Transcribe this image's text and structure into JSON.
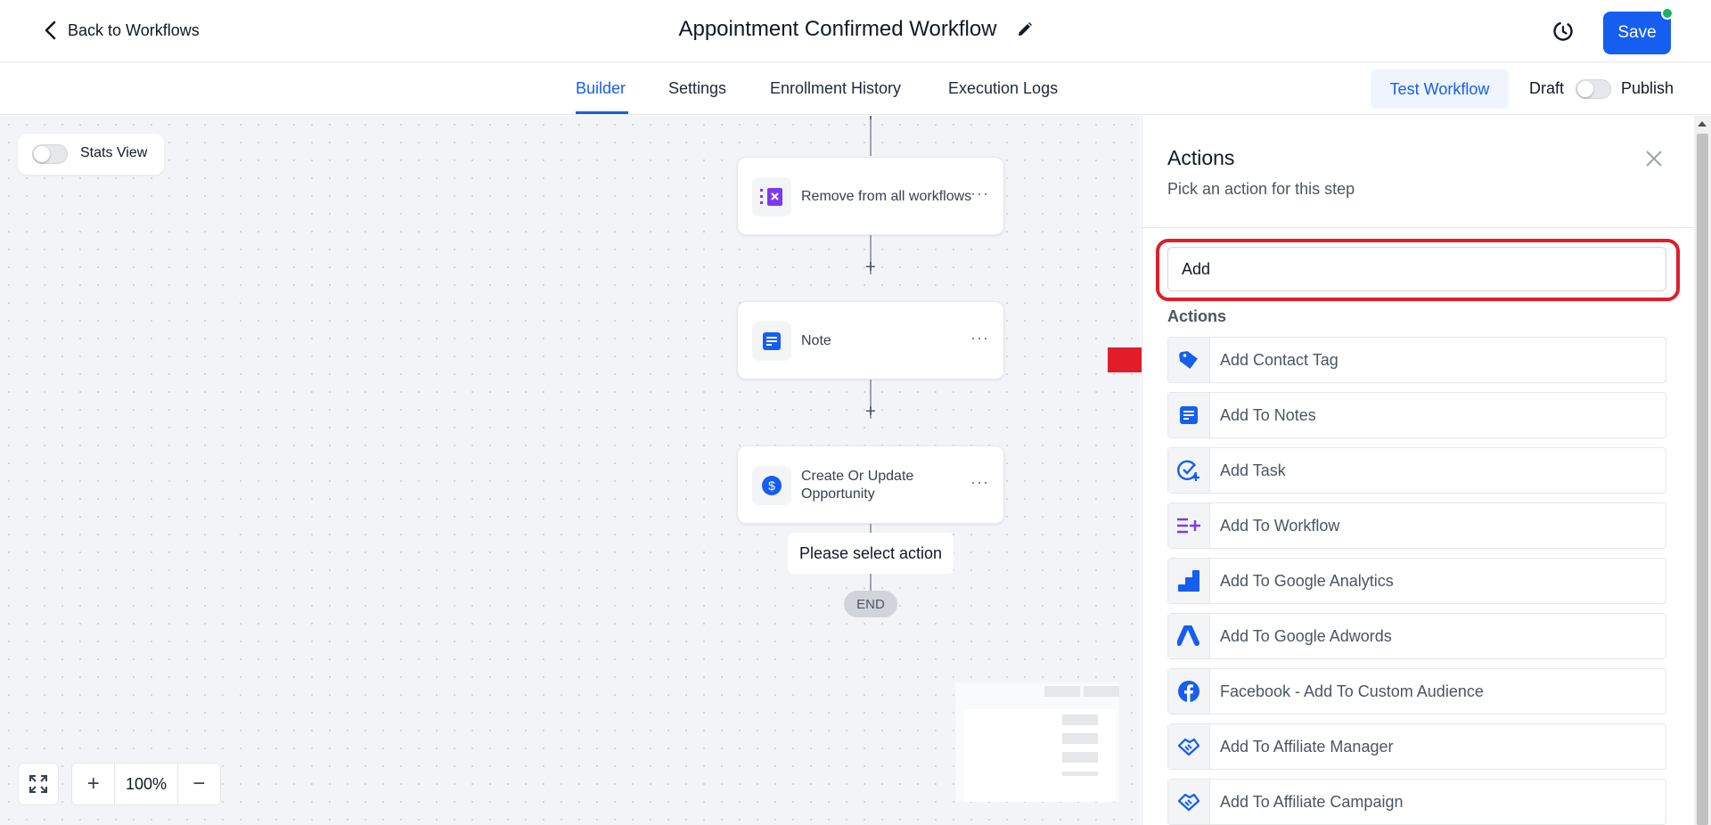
{
  "header": {
    "back_label": "Back to Workflows",
    "title": "Appointment Confirmed Workflow",
    "save_label": "Save",
    "save_status_color": "#16b364"
  },
  "tabs": {
    "items": [
      {
        "label": "Builder"
      },
      {
        "label": "Settings"
      },
      {
        "label": "Enrollment History"
      },
      {
        "label": "Execution Logs"
      }
    ],
    "active": "Builder",
    "test_workflow_label": "Test Workflow",
    "draft_label": "Draft",
    "publish_label": "Publish",
    "publish_toggle_on": false
  },
  "canvas": {
    "stats_view_label": "Stats View",
    "stats_view_on": false,
    "nodes": [
      {
        "label": "Remove from all workflows",
        "icon": "remove-workflow-icon",
        "icon_color": "#7c3aed"
      },
      {
        "label": "Note",
        "icon": "note-icon",
        "icon_color": "#155eef"
      },
      {
        "label_line1": "Create Or Update",
        "label_line2": "Opportunity",
        "icon": "dollar-icon",
        "icon_color": "#155eef"
      }
    ],
    "add_step_symbol": "+",
    "more_symbol": "···",
    "select_action_message": "Please select action",
    "end_label": "END",
    "zoom_in_symbol": "+",
    "zoom_out_symbol": "−",
    "zoom_level": "100%"
  },
  "panel": {
    "title": "Actions",
    "subtitle": "Pick an action for this step",
    "search_value": "Add",
    "section_label": "Actions",
    "highlight_color": "#e11d2a",
    "items": [
      {
        "label": "Add Contact Tag",
        "icon": "tag-icon"
      },
      {
        "label": "Add To Notes",
        "icon": "notes-icon"
      },
      {
        "label": "Add Task",
        "icon": "task-icon"
      },
      {
        "label": "Add To Workflow",
        "icon": "add-workflow-icon"
      },
      {
        "label": "Add To Google Analytics",
        "icon": "google-analytics-icon"
      },
      {
        "label": "Add To Google Adwords",
        "icon": "google-adwords-icon"
      },
      {
        "label": "Facebook - Add To Custom Audience",
        "icon": "facebook-icon"
      },
      {
        "label": "Add To Affiliate Manager",
        "icon": "affiliate-icon"
      },
      {
        "label": "Add To Affiliate Campaign",
        "icon": "affiliate-campaign-icon"
      }
    ]
  },
  "colors": {
    "accent": "#155eef",
    "canvas_bg": "#f3f4f8"
  }
}
